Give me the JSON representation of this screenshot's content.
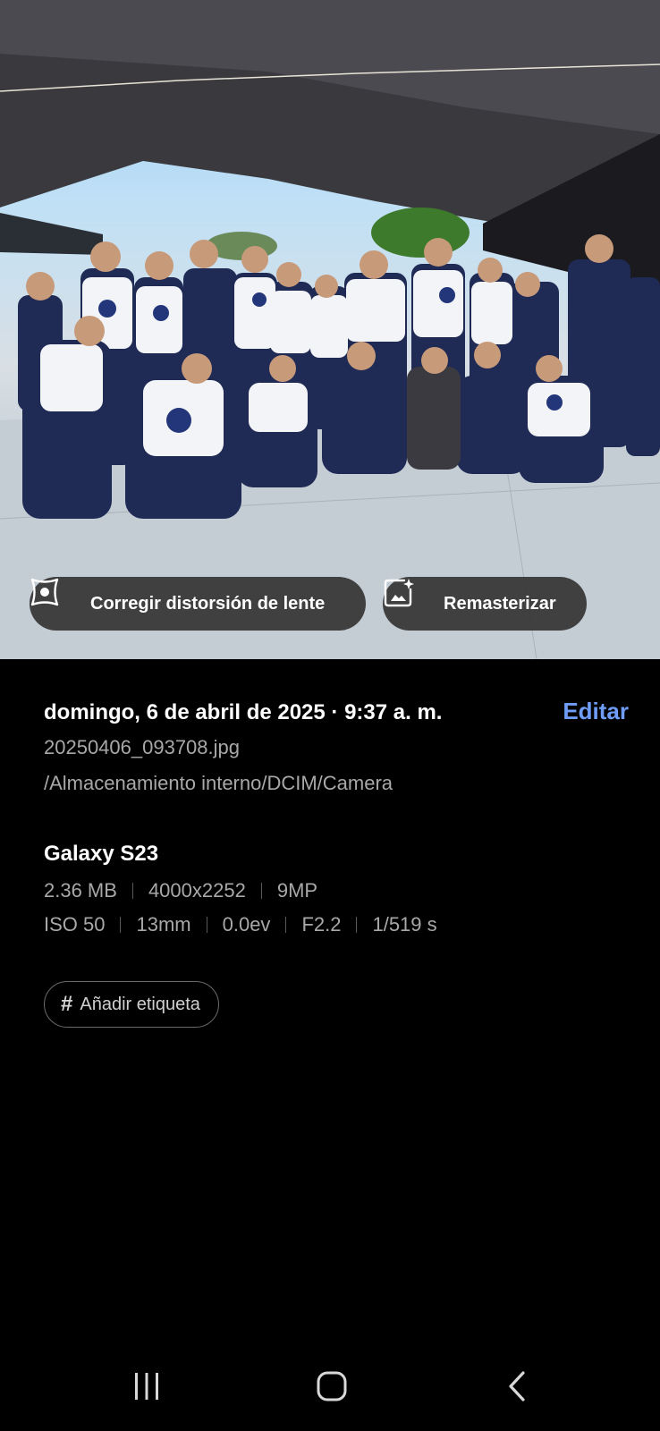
{
  "photo": {
    "actions": {
      "lens_correction_label": "Corregir distorsión de lente",
      "remaster_label": "Remasterizar"
    }
  },
  "details": {
    "datetime": "domingo, 6 de abril de 2025 · 9:37 a. m.",
    "edit_label": "Editar",
    "filename": "20250406_093708.jpg",
    "path": "/Almacenamiento interno/DCIM/Camera",
    "device": "Galaxy S23",
    "specs_row1": [
      "2.36 MB",
      "4000x2252",
      "9MP"
    ],
    "specs_row2": [
      "ISO 50",
      "13mm",
      "0.0ev",
      "F2.2",
      "1/519 s"
    ],
    "add_tag_label": "Añadir etiqueta"
  },
  "navbar": {
    "recent_icon": "recent-apps-icon",
    "home_icon": "home-icon",
    "back_icon": "back-icon"
  },
  "colors": {
    "background": "#000000",
    "accent": "#6f9cf7",
    "chip_bg": "#343434",
    "secondary_text": "#a8a8a8"
  }
}
